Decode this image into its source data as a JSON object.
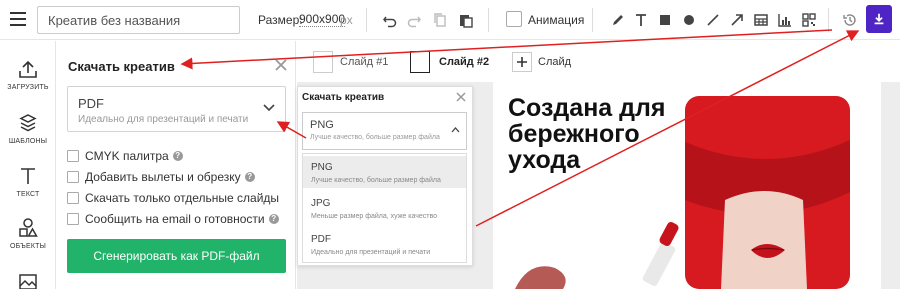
{
  "topbar": {
    "title_value": "Креатив без названия",
    "size_label": "Размер:",
    "size_value": "900x900",
    "size_unit": "px",
    "animation_label": "Анимация",
    "accent_color": "#4f24c4"
  },
  "rail": {
    "items": [
      {
        "label": "ЗАГРУЗИТЬ",
        "icon": "upload-icon"
      },
      {
        "label": "ШАБЛОНЫ",
        "icon": "templates-icon"
      },
      {
        "label": "ТЕКСТ",
        "icon": "text-icon"
      },
      {
        "label": "ОБЪЕКТЫ",
        "icon": "shapes-icon"
      },
      {
        "label": "",
        "icon": "image-icon"
      }
    ]
  },
  "panel": {
    "title": "Скачать креатив",
    "format_name": "PDF",
    "format_desc": "Идеально для презентаций и печати",
    "options": [
      {
        "label": "CMYK палитра",
        "help": true
      },
      {
        "label": "Добавить вылеты и обрезку",
        "help": true
      },
      {
        "label": "Скачать только отдельные слайды",
        "help": false
      },
      {
        "label": "Сообщить на email о готовности",
        "help": true
      }
    ],
    "generate_label": "Сгенерировать как PDF-файл",
    "generate_color": "#22b36a"
  },
  "slides": {
    "items": [
      {
        "label": "Слайд #1",
        "active": false
      },
      {
        "label": "Слайд #2",
        "active": true
      }
    ],
    "add_label": "Слайд"
  },
  "popup": {
    "title": "Скачать креатив",
    "selected_name": "PNG",
    "selected_desc": "Лучше качество, больше размер файла",
    "options": [
      {
        "name": "PNG",
        "desc": "Лучше качество, больше размер файла"
      },
      {
        "name": "JPG",
        "desc": "Меньше размер файла, хуже качество"
      },
      {
        "name": "PDF",
        "desc": "Идеально для презентаций и печати"
      }
    ]
  },
  "canvas": {
    "headline": "Создана для бережного ухода",
    "accent_red": "#d71920"
  },
  "annotation_color": "#e02020"
}
